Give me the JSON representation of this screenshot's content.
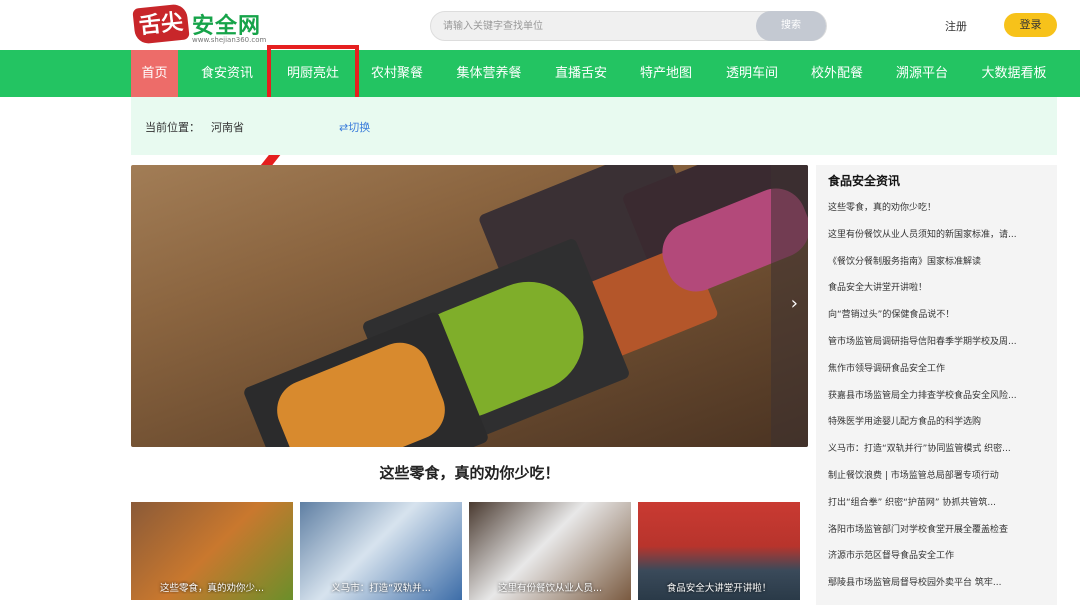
{
  "header": {
    "logo_text": "安全网",
    "logo_mark": "舌尖",
    "logo_url": "www.shejian360.com",
    "search_placeholder": "请输入关键字查找单位",
    "search_button": "搜索",
    "register": "注册",
    "login": "登录"
  },
  "nav": [
    "首页",
    "食安资讯",
    "明厨亮灶",
    "农村聚餐",
    "集体营养餐",
    "直播舌安",
    "特产地图",
    "透明车间",
    "校外配餐",
    "溯源平台",
    "大数据看板"
  ],
  "location": {
    "label": "当前位置：",
    "province": "河南省",
    "switch": "⇄切换"
  },
  "banner": {
    "caption": "这些零食，真的劝你少吃！",
    "next": "›"
  },
  "thumbnails": [
    "这些零食，真的劝你少...",
    "义马市：打造“双轨并...",
    "这里有份餐饮从业人员...",
    "食品安全大讲堂开讲啦！"
  ],
  "news": {
    "title": "食品安全资讯",
    "items": [
      "这些零食，真的劝你少吃！",
      "这里有份餐饮从业人员须知的新国家标准，请...",
      "《餐饮分餐制服务指南》国家标准解读",
      "食品安全大讲堂开讲啦！",
      "向“营销过头”的保健食品说不！",
      "管市场监管局调研指导信阳春季学期学校及周...",
      "焦作市领导调研食品安全工作",
      "获嘉县市场监管局全力排查学校食品安全风险...",
      "特殊医学用途婴儿配方食品的科学选购",
      "义马市：打造“双轨并行”协同监管模式 织密...",
      "制止餐饮浪费 | 市场监管总局部署专项行动",
      "打出“组合拳” 织密“护苗网” 协抓共管筑...",
      "洛阳市场监管部门对学校食堂开展全覆盖检查",
      "济源市示范区督导食品安全工作",
      "鄢陵县市场监管局督导校园外卖平台 筑牢..."
    ]
  },
  "colors": {
    "nav_green": "#23c462",
    "active_red": "#ed6c69",
    "login_yellow": "#f7c21a",
    "highlight_red": "#e51f1f"
  }
}
